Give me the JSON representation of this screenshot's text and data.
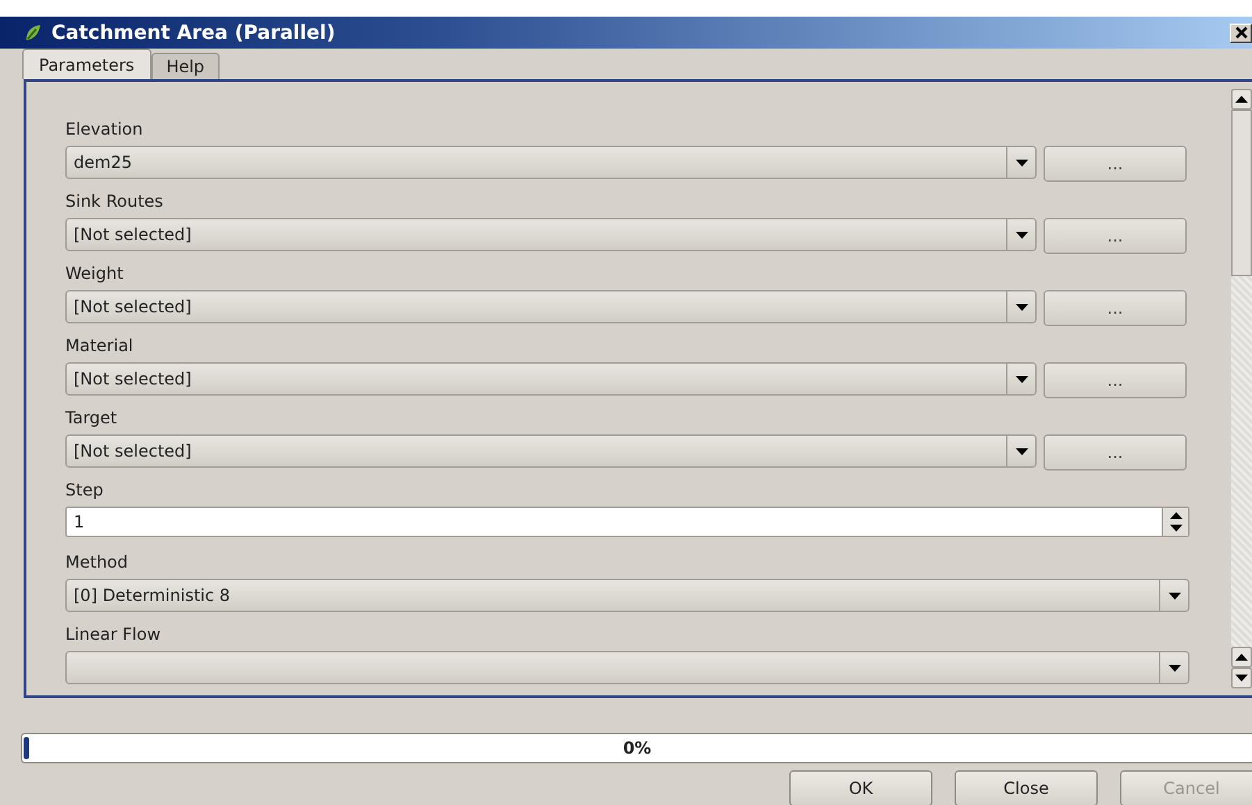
{
  "window": {
    "title": "Catchment Area (Parallel)"
  },
  "tabs": [
    {
      "label": "Parameters",
      "selected": true
    },
    {
      "label": "Help",
      "selected": false
    }
  ],
  "parameters": [
    {
      "kind": "layer",
      "label": "Elevation",
      "value": "dem25",
      "button": "..."
    },
    {
      "kind": "layer",
      "label": "Sink Routes",
      "value": "[Not selected]",
      "button": "..."
    },
    {
      "kind": "layer",
      "label": "Weight",
      "value": "[Not selected]",
      "button": "..."
    },
    {
      "kind": "layer",
      "label": "Material",
      "value": "[Not selected]",
      "button": "..."
    },
    {
      "kind": "layer",
      "label": "Target",
      "value": "[Not selected]",
      "button": "..."
    },
    {
      "kind": "number",
      "label": "Step",
      "value": "1"
    },
    {
      "kind": "choice",
      "label": "Method",
      "value": "[0] Deterministic 8"
    },
    {
      "kind": "choice",
      "label": "Linear Flow"
    }
  ],
  "progress": {
    "level": 0,
    "text": "0%"
  },
  "buttons": [
    {
      "label": "OK",
      "disabled": false
    },
    {
      "label": "Close",
      "disabled": false
    },
    {
      "label": "Cancel",
      "disabled": true
    }
  ]
}
